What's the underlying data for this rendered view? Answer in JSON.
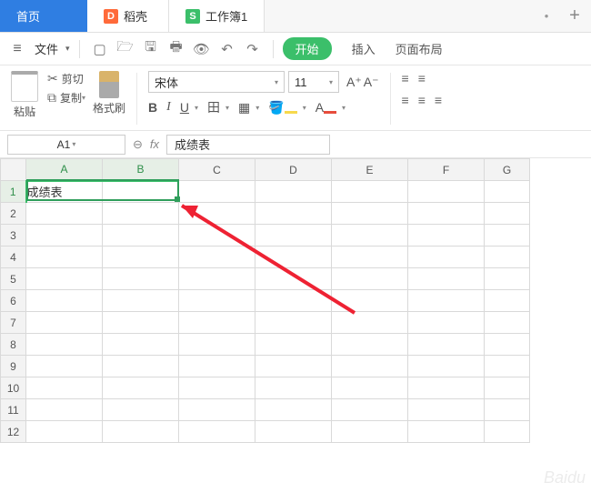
{
  "tabs": {
    "home": "首页",
    "doc_icon": "D",
    "doc": "稻壳",
    "wb_icon": "S",
    "wb": "工作簿1"
  },
  "menubar": {
    "file": "文件",
    "start": "开始",
    "insert": "插入",
    "page_layout": "页面布局"
  },
  "ribbon": {
    "paste": "粘贴",
    "cut": "剪切",
    "copy": "复制",
    "format_painter": "格式刷",
    "font_name": "宋体",
    "font_size": "11",
    "a_plus": "A⁺",
    "a_minus": "A⁻",
    "bold": "B",
    "italic": "I",
    "underline": "U",
    "font_a": "A"
  },
  "namebar": {
    "cell_ref": "A1",
    "fx": "fx",
    "value": "成绩表"
  },
  "grid": {
    "columns": [
      "A",
      "B",
      "C",
      "D",
      "E",
      "F",
      "G"
    ],
    "rows": [
      "1",
      "2",
      "3",
      "4",
      "5",
      "6",
      "7",
      "8",
      "9",
      "10",
      "11",
      "12"
    ],
    "a1": "成绩表"
  }
}
